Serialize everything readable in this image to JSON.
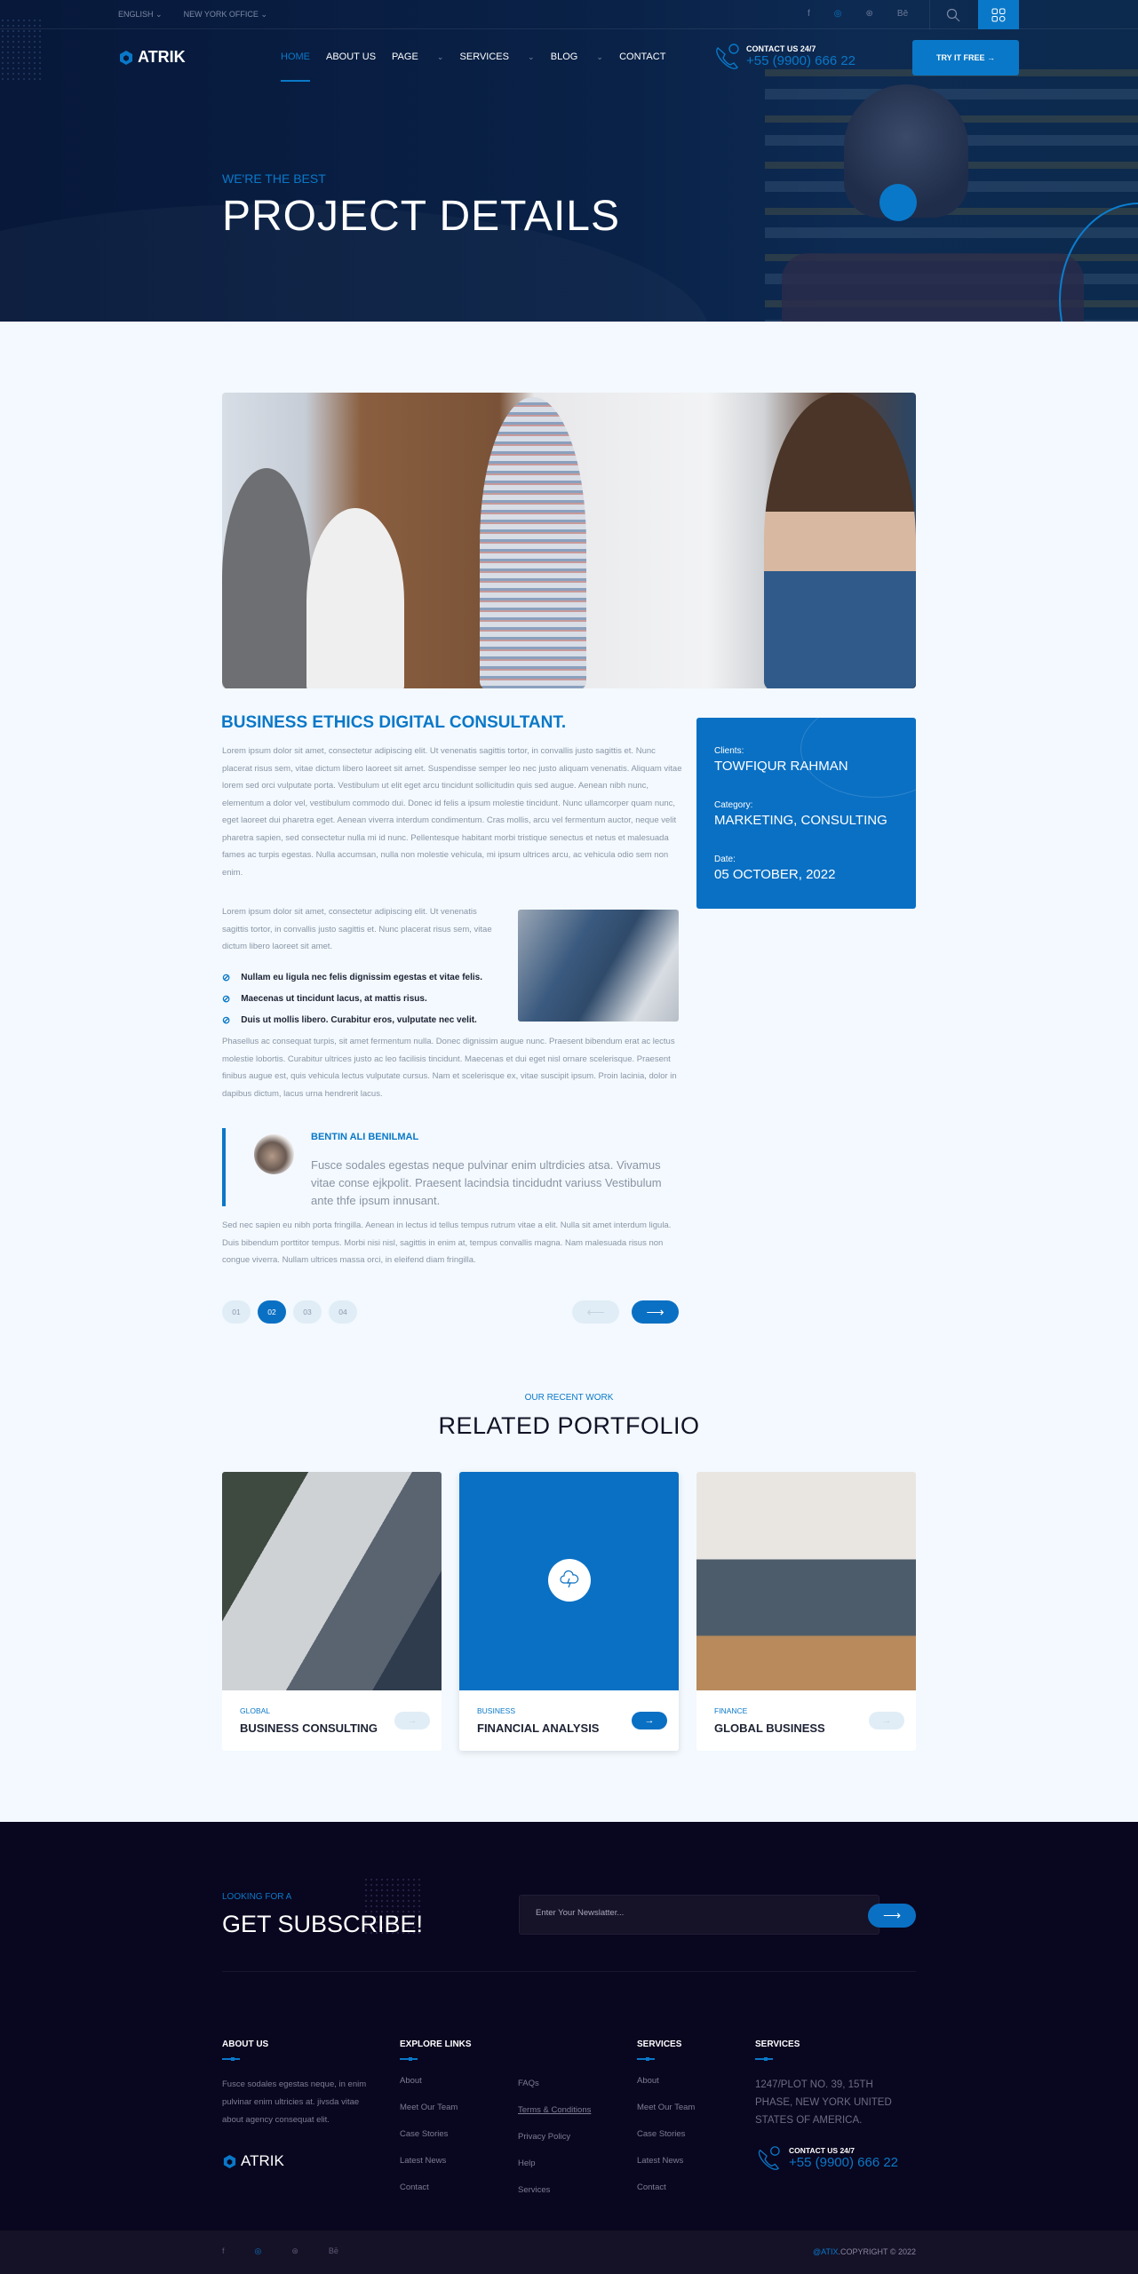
{
  "topbar": {
    "language": "ENGLISH",
    "office": "NEW YORK OFFICE",
    "socials": [
      {
        "name": "facebook",
        "glyph": "f"
      },
      {
        "name": "instagram",
        "glyph": "◎"
      },
      {
        "name": "dribbble",
        "glyph": "⊛"
      },
      {
        "name": "behance",
        "glyph": "Bē"
      }
    ]
  },
  "nav": {
    "brand": "ATRIK",
    "items": [
      {
        "label": "HOME",
        "caret": false
      },
      {
        "label": "ABOUT US",
        "caret": false
      },
      {
        "label": "PAGE",
        "caret": true
      },
      {
        "label": "SERVICES",
        "caret": true
      },
      {
        "label": "BLOG",
        "caret": true
      },
      {
        "label": "CONTACT",
        "caret": false
      }
    ],
    "contact_label": "CONTACT US 24/7",
    "phone": "+55 (9900) 666 22",
    "cta": "TRY IT FREE →"
  },
  "hero": {
    "subtitle": "WE'RE THE BEST",
    "title": "PROJECT DETAILS"
  },
  "project": {
    "title": "BUSINESS ETHICS DIGITAL CONSULTANT.",
    "paragraph_1": "Lorem ipsum dolor sit amet, consectetur adipiscing elit. Ut venenatis sagittis tortor, in convallis justo sagittis et. Nunc placerat risus sem, vitae dictum libero laoreet sit amet. Suspendisse semper leo nec justo aliquam venenatis. Aliquam vitae lorem sed orci vulputate porta. Vestibulum ut elit eget arcu tincidunt sollicitudin quis sed augue. Aenean nibh nunc, elementum a dolor vel, vestibulum commodo dui. Donec id felis a ipsum molestie tincidunt. Nunc ullamcorper quam nunc, eget laoreet dui pharetra eget. Aenean viverra interdum condimentum. Cras mollis, arcu vel fermentum auctor, neque velit pharetra sapien, sed consectetur nulla mi id nunc. Pellentesque habitant morbi tristique senectus et netus et malesuada fames ac turpis egestas. Nulla accumsan, nulla non molestie vehicula, mi ipsum ultrices arcu, ac vehicula odio sem non enim.",
    "paragraph_2": "Lorem ipsum dolor sit amet, consectetur adipiscing elit. Ut venenatis sagittis tortor, in convallis justo sagittis et. Nunc placerat risus sem, vitae dictum libero laoreet sit amet.",
    "checklist": [
      "Nullam eu ligula nec felis dignissim egestas et vitae felis.",
      "Maecenas ut tincidunt lacus, at mattis risus.",
      "Duis ut mollis libero. Curabitur eros, vulputate nec velit."
    ],
    "paragraph_3": "Phasellus ac consequat turpis, sit amet fermentum nulla. Donec dignissim augue nunc. Praesent bibendum erat ac lectus molestie lobortis. Curabitur ultrices justo ac leo facilisis tincidunt. Maecenas et dui eget nisl ornare scelerisque. Praesent finibus augue est, quis vehicula lectus vulputate cursus. Nam et scelerisque ex, vitae suscipit ipsum. Proin lacinia, dolor in dapibus dictum, lacus urna hendrerit lacus.",
    "quote": {
      "author": "BENTIN ALI BENILMAL",
      "text": "Fusce sodales egestas neque pulvinar enim ultrdicies atsa. Vivamus vitae conse ejkpolit. Praesent lacindsia tincidudnt variuss Vestibulum ante thfe ipsum innusant."
    },
    "paragraph_4": "Sed nec sapien eu nibh porta fringilla. Aenean in lectus id tellus tempus rutrum vitae a elit. Nulla sit amet interdum ligula. Duis bibendum porttitor tempus. Morbi nisi nisl, sagittis in enim at, tempus convallis magna. Nam malesuada risus non congue viverra. Nullam ultrices massa orci, in eleifend diam fringilla.",
    "info": [
      {
        "label": "Clients:",
        "value": "TOWFIQUR RAHMAN"
      },
      {
        "label": "Category:",
        "value": "MARKETING, CONSULTING"
      },
      {
        "label": "Date:",
        "value": "05 OCTOBER, 2022"
      }
    ],
    "pagination": {
      "pages": [
        "01",
        "02",
        "03",
        "04"
      ],
      "current": "02",
      "prev": "⟵",
      "next": "⟶"
    }
  },
  "related": {
    "subtitle": "OUR RECENT WORK",
    "title": "RELATED PORTFOLIO",
    "items": [
      {
        "category": "GLOBAL",
        "title": "BUSINESS CONSULTING",
        "active": false
      },
      {
        "category": "BUSINESS",
        "title": "FINANCIAL ANALYSIS",
        "active": true
      },
      {
        "category": "FINANCE",
        "title": "GLOBAL BUSINESS",
        "active": false
      }
    ],
    "arrow": "→"
  },
  "footer": {
    "subscribe_sub": "LOOKING FOR A",
    "subscribe_title": "GET SUBSCRIBE!",
    "newsletter_placeholder": "Enter Your Newslatter...",
    "about": {
      "heading": "ABOUT US",
      "text": "Fusce sodales egestas neque, in enim pulvinar enim ultricies at. jivsda vitae about agency  consequat elit.",
      "brand": "ATRIK"
    },
    "explore": {
      "heading": "EXPLORE LINKS",
      "col1": [
        "About",
        "Meet Our Team",
        "Case Stories",
        "Latest News",
        "Contact"
      ],
      "col2": [
        "FAQs",
        "Terms & Conditions",
        "Privacy Policy",
        "Help",
        "Services"
      ]
    },
    "services": {
      "heading": "SERVICES",
      "links": [
        "About",
        "Meet Our Team",
        "Case Stories",
        "Latest News",
        "Contact"
      ]
    },
    "contact": {
      "heading": "SERVICES",
      "address": "1247/PLOT NO. 39, 15TH PHASE, NEW YORK UNITED STATES OF AMERICA.",
      "label": "CONTACT US 24/7",
      "phone": "+55 (9900) 666 22"
    },
    "copyright_brand": "@ATIX",
    "copyright_text": ".COPYRIGHT © 2022"
  },
  "colors": {
    "accent": "#0a78c8",
    "footer_bg": "#09061f",
    "hero_bg": "#07183a"
  }
}
